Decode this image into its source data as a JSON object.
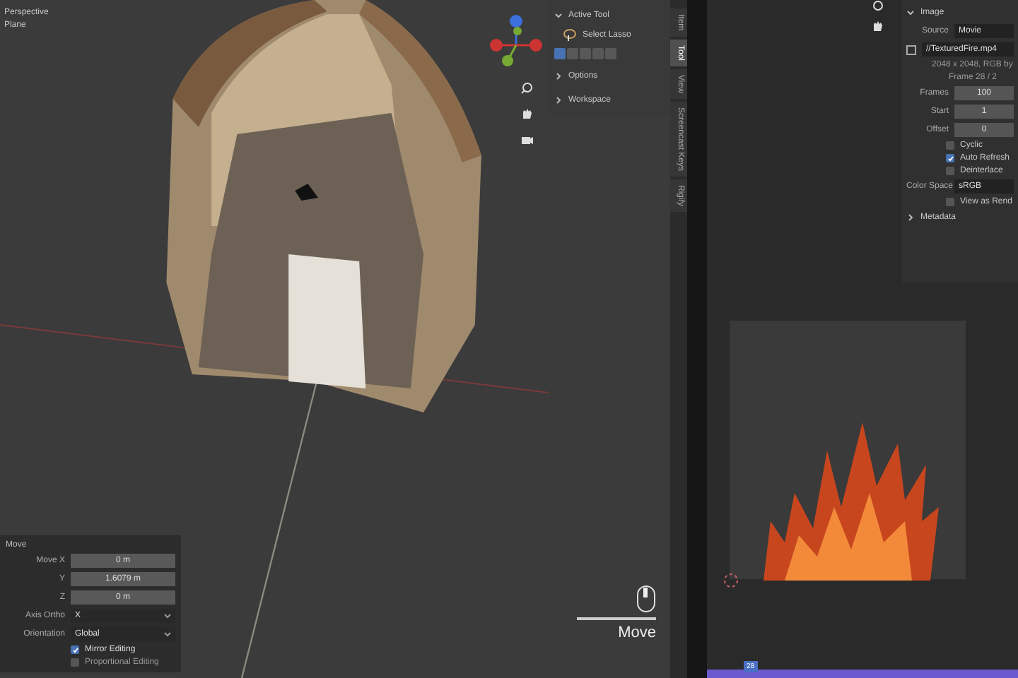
{
  "viewport": {
    "view_name": "Perspective",
    "object_name": "Plane"
  },
  "sidebar": {
    "active_tool": {
      "title": "Active Tool",
      "expanded": true,
      "tool_name": "Select Lasso"
    },
    "select_modes": [
      {
        "selected": true
      },
      {
        "selected": false
      },
      {
        "selected": false
      },
      {
        "selected": false
      },
      {
        "selected": false
      }
    ],
    "sections": [
      {
        "title": "Options",
        "expanded": false
      },
      {
        "title": "Workspace",
        "expanded": false
      }
    ],
    "tabs": [
      {
        "label": "Item",
        "selected": false
      },
      {
        "label": "Tool",
        "selected": true
      },
      {
        "label": "View",
        "selected": false
      },
      {
        "label": "Screencast Keys",
        "selected": false
      },
      {
        "label": "Rigify",
        "selected": false
      }
    ]
  },
  "operator_panel": {
    "title": "Move",
    "fields": [
      {
        "label": "Move X",
        "value": "0 m"
      },
      {
        "label": "Y",
        "value": "1.6079 m"
      },
      {
        "label": "Z",
        "value": "0 m"
      }
    ],
    "dropdowns": [
      {
        "label": "Axis Ortho",
        "value": "X"
      },
      {
        "label": "Orientation",
        "value": "Global"
      }
    ],
    "checkboxes": [
      {
        "label": "Mirror Editing",
        "checked": true
      },
      {
        "label": "Proportional Editing",
        "checked": false
      }
    ]
  },
  "screencast": {
    "label": "Move"
  },
  "image_panel": {
    "title": "Image",
    "source": {
      "label": "Source",
      "value": "Movie"
    },
    "file": "//TexturedFire.mp4",
    "info": "2048 x 2048, RGB by",
    "frame_info": "Frame 28 / 2",
    "fields": [
      {
        "label": "Frames",
        "value": "100"
      },
      {
        "label": "Start",
        "value": "1"
      },
      {
        "label": "Offset",
        "value": "0"
      }
    ],
    "checkboxes": [
      {
        "label": "Cyclic",
        "checked": false
      },
      {
        "label": "Auto Refresh",
        "checked": true
      },
      {
        "label": "Deinterlace",
        "checked": false
      }
    ],
    "color_space": {
      "label": "Color Space",
      "value": "sRGB"
    },
    "view_as_render": {
      "label": "View as Rend",
      "checked": false
    },
    "metadata": {
      "title": "Metadata",
      "expanded": false
    }
  },
  "timeline": {
    "current_frame": "28"
  }
}
